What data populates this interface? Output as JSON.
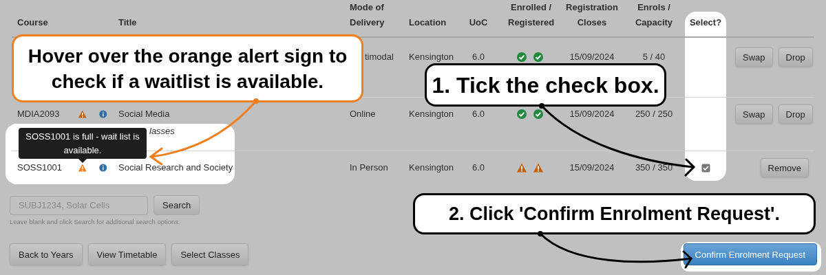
{
  "table": {
    "columns": [
      "Course",
      "Title",
      "Mode of Delivery",
      "Location",
      "UoC",
      "Enrolled / Registered",
      "Registration Closes",
      "Enrols / Capacity",
      "Select?"
    ],
    "rows": [
      {
        "mode": "timodal",
        "location": "Kensington",
        "uoc": "6.0",
        "status": [
          {
            "kind": "ok"
          },
          {
            "kind": "ok"
          }
        ],
        "closes": "15/09/2024",
        "enrols": "5 / 40",
        "actions": [
          "Swap",
          "Drop"
        ]
      },
      {
        "course": "MDIA2093",
        "alert": true,
        "info": true,
        "title": "Social Media",
        "note": "lasses",
        "mode": "Online",
        "location": "Kensington",
        "uoc": "6.0",
        "status": [
          {
            "kind": "ok"
          },
          {
            "kind": "ok"
          }
        ],
        "closes": "15/09/2024",
        "enrols": "250 / 250",
        "actions": [
          "Swap",
          "Drop"
        ]
      },
      {
        "course": "SOSS1001",
        "alert": true,
        "info": true,
        "title": "Social Research and Society",
        "mode": "In Person",
        "location": "Kensington",
        "uoc": "6.0",
        "status": [
          {
            "kind": "alert"
          },
          {
            "kind": "alert"
          }
        ],
        "closes": "15/09/2024",
        "enrols": "350 / 350",
        "select": {
          "checked": true
        },
        "actions": [
          "Remove"
        ]
      }
    ]
  },
  "tooltip": {
    "text": "SOSS1001 is full - wait list is available."
  },
  "search": {
    "placeholder": "SUBJ1234, Solar Cells",
    "button": "Search",
    "hint": "Leave blank and click Search for additional search options."
  },
  "footer_buttons": [
    "Back to Years",
    "View Timetable",
    "Select Classes"
  ],
  "confirm_button": "Confirm Enrolment Request",
  "callouts": [
    {
      "text": "Hover over the orange alert sign to check if a waitlist is available.",
      "color": "#f07f1f"
    },
    {
      "text": "1. Tick the check box.",
      "color": "#000000"
    },
    {
      "text": "2. Click 'Confirm Enrolment Request'.",
      "color": "#000000"
    }
  ]
}
